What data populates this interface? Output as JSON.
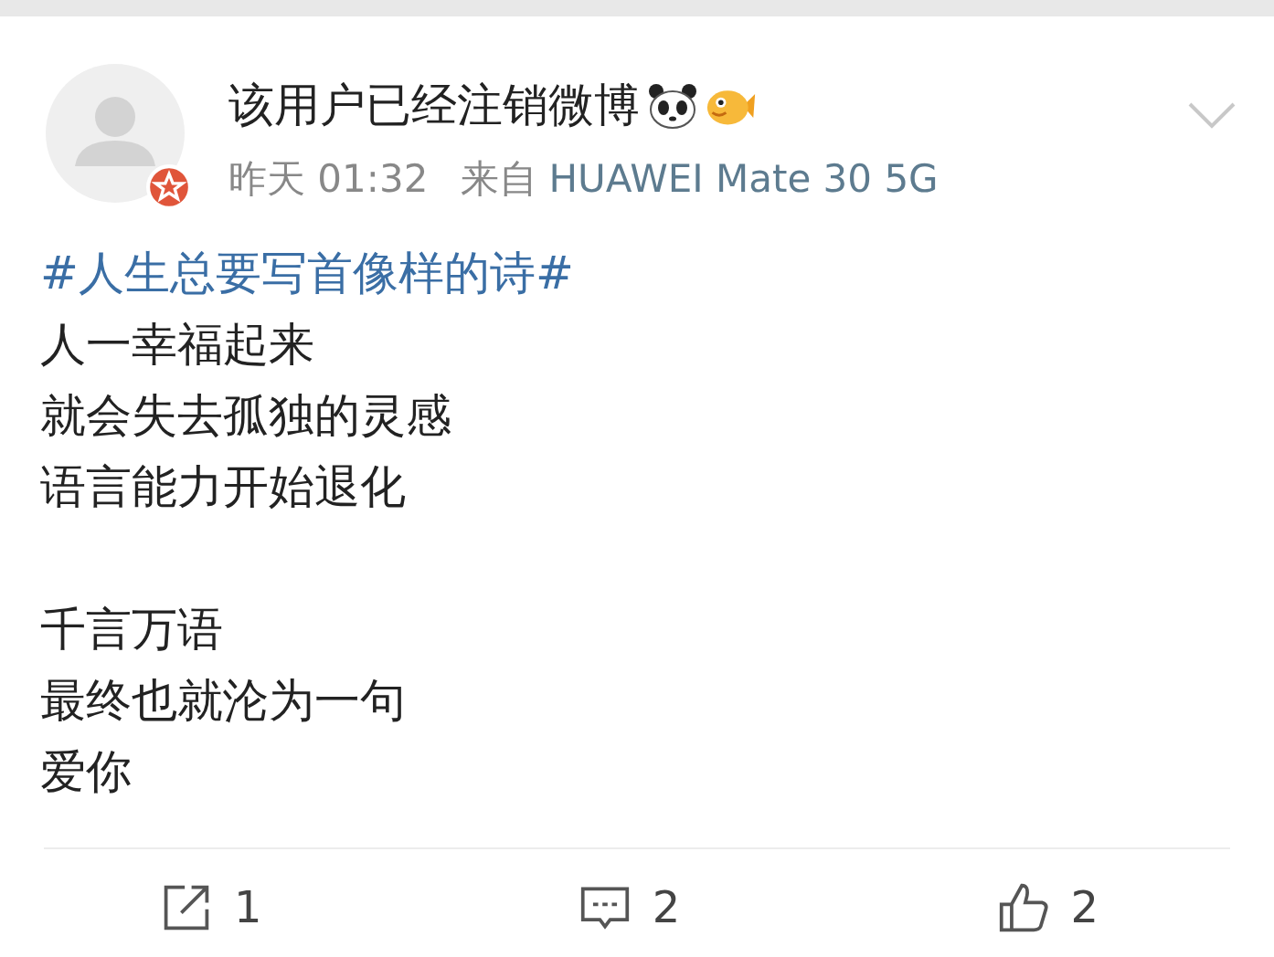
{
  "post": {
    "author": "该用户已经注销微博",
    "time": "昨天 01:32",
    "source_prefix": "来自",
    "source": "HUAWEI Mate 30 5G",
    "hashtag": "#人生总要写首像样的诗#",
    "stanzas": [
      [
        "人一幸福起来",
        "就会失去孤独的灵感",
        "语言能力开始退化"
      ],
      [
        "千言万语",
        "最终也就沦为一句",
        "爱你"
      ]
    ]
  },
  "actions": [
    {
      "kind": "share",
      "count": "1"
    },
    {
      "kind": "comment",
      "count": "2"
    },
    {
      "kind": "like",
      "count": "2"
    }
  ]
}
